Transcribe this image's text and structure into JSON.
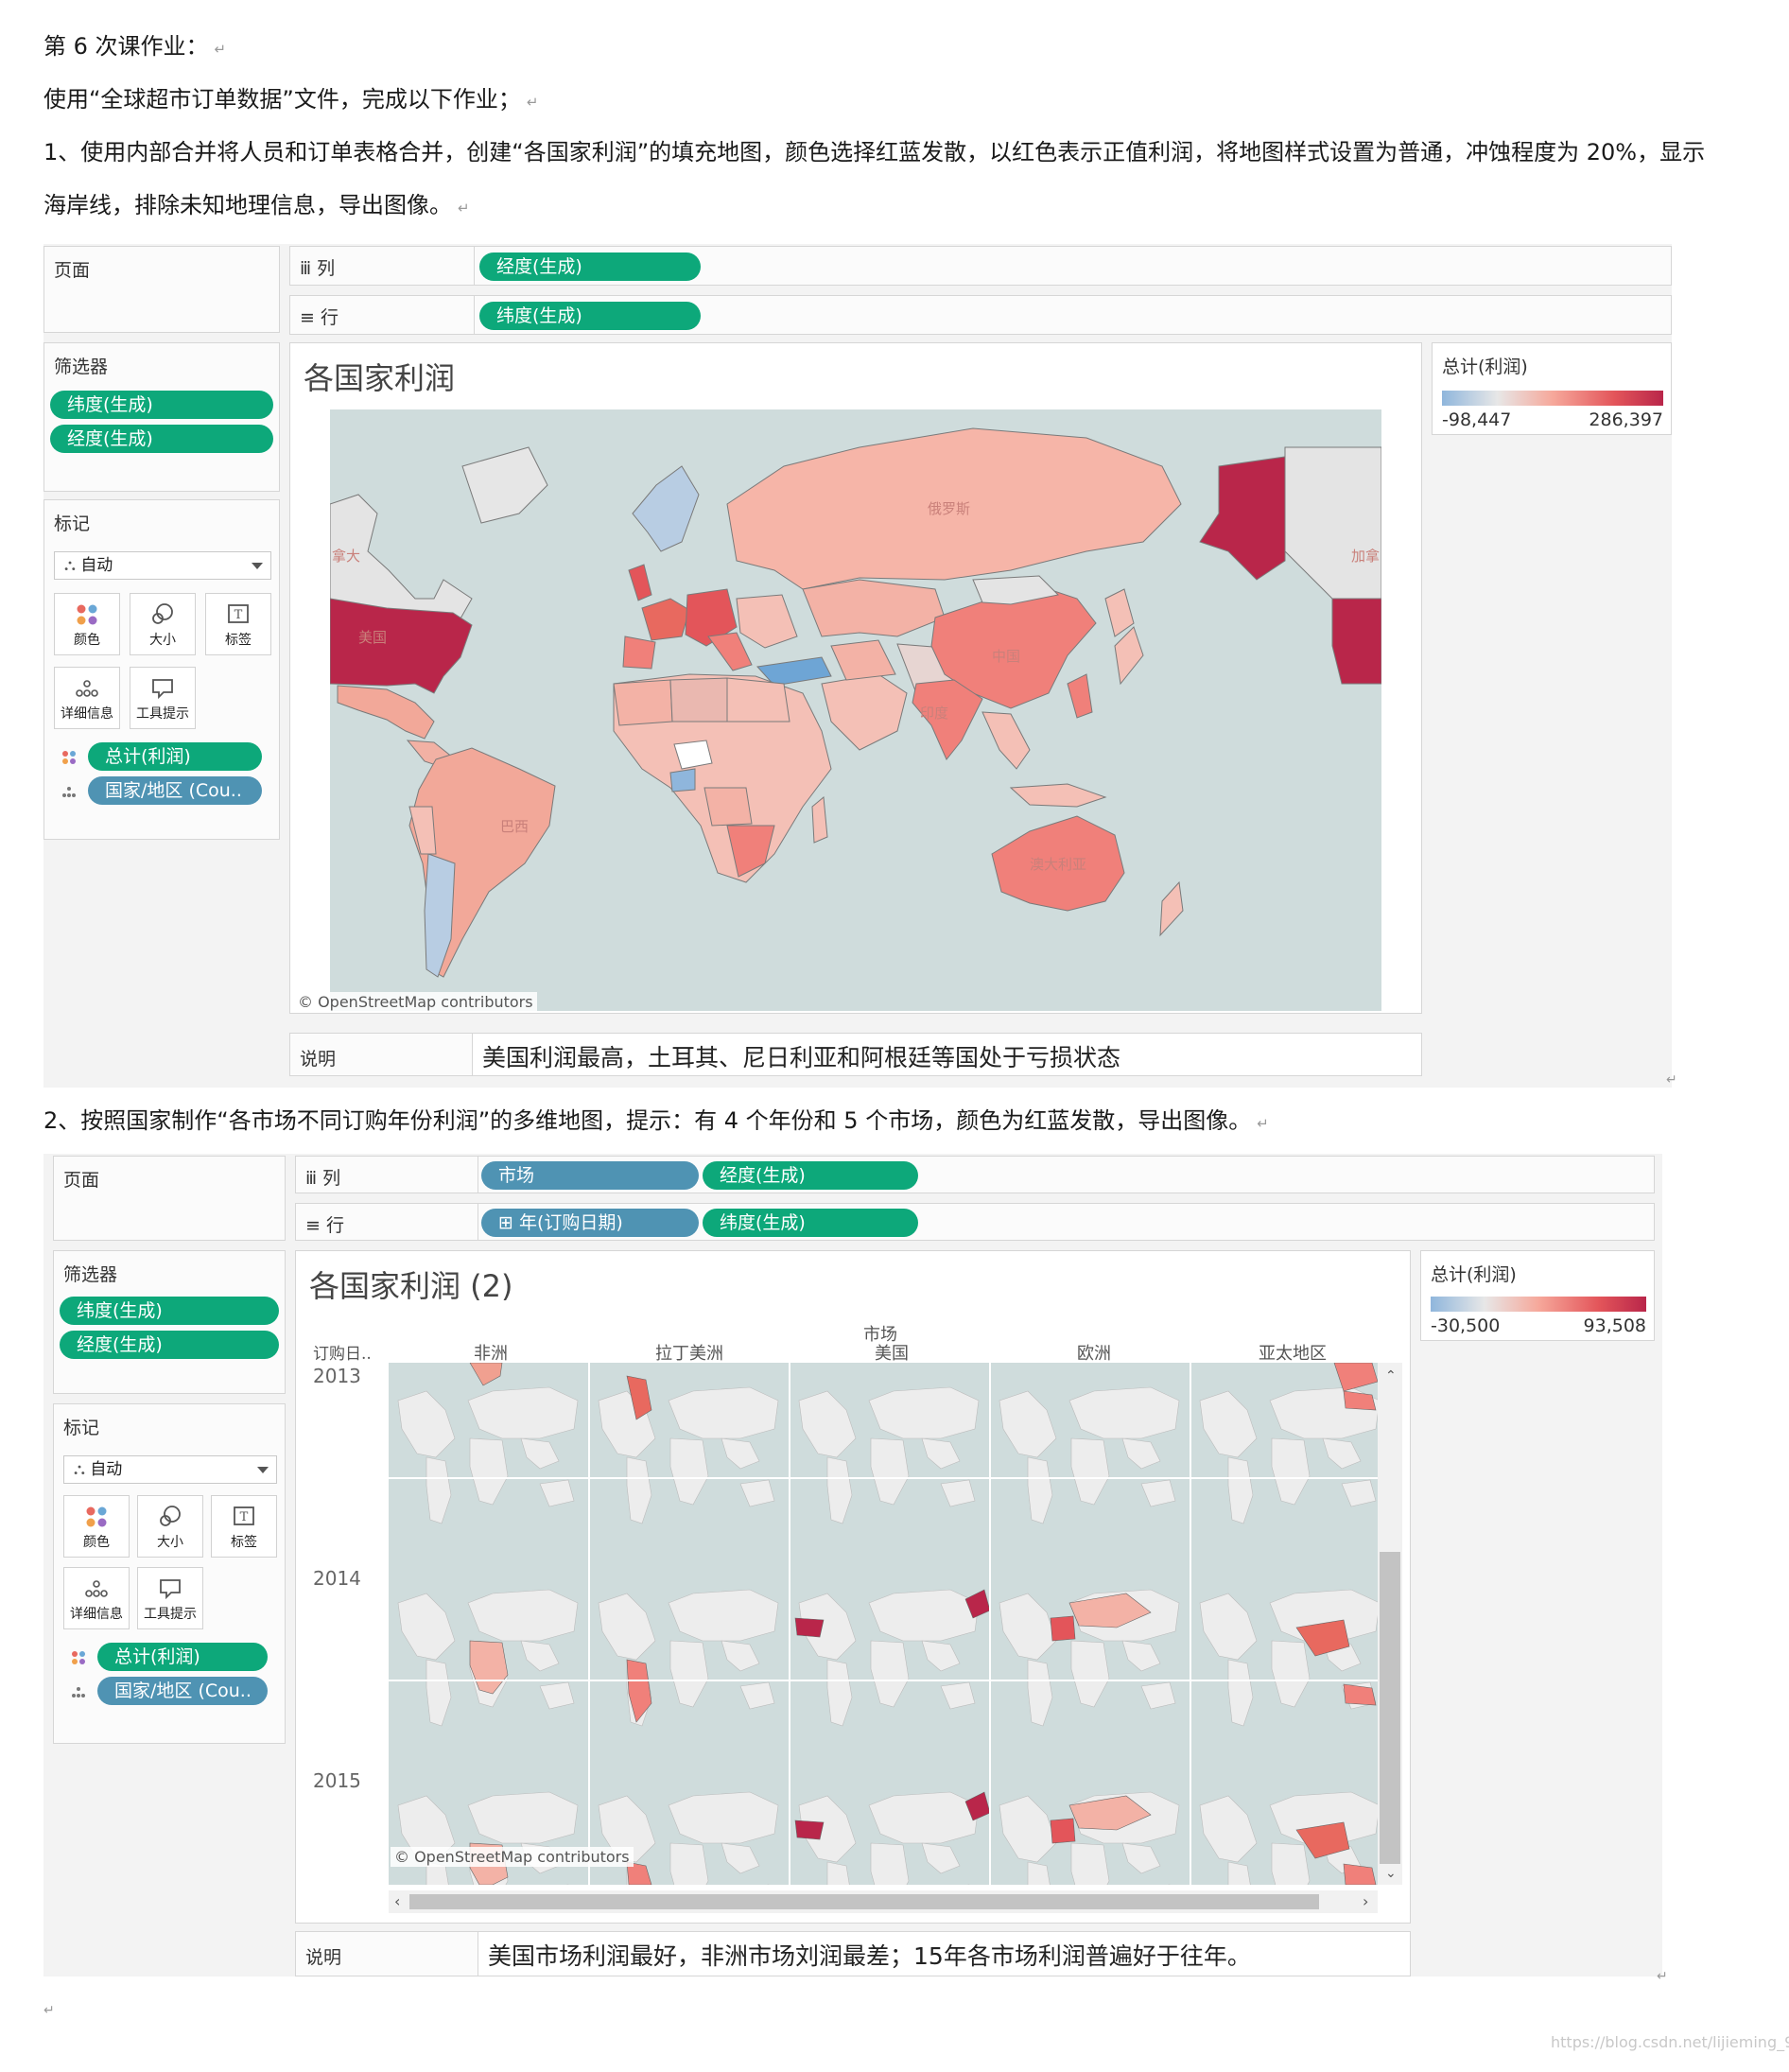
{
  "doc": {
    "line1": "第 6 次课作业：",
    "line2": "使用“全球超市订单数据”文件，完成以下作业；",
    "line3": "1、使用内部合并将人员和订单表格合并，创建“各国家利润”的填充地图，颜色选择红蓝发散，以红色表示正值利润，将地图样式设置为普通，冲蚀程度为 20%，显示",
    "line4": "海岸线，排除未知地理信息，导出图像。",
    "line5": "2、按照国家制作“各市场不同订购年份利润”的多维地图，提示：有 4 个年份和 5 个市场，颜色为红蓝发散，导出图像。",
    "para_mark": "↵",
    "watermark": "https://blog.csdn.net/lijieming_95"
  },
  "viz1": {
    "pages_label": "页面",
    "columns_label": "列",
    "rows_label": "行",
    "columns_pills": [
      "经度(生成)"
    ],
    "rows_pills": [
      "纬度(生成)"
    ],
    "filters_label": "筛选器",
    "filters": [
      "纬度(生成)",
      "经度(生成)"
    ],
    "marks_label": "标记",
    "mark_type": "自动",
    "mark_buttons": [
      "颜色",
      "大小",
      "标签",
      "详细信息",
      "工具提示"
    ],
    "mark_fields": [
      "总计(利润)",
      "国家/地区 (Cou.."
    ],
    "title": "各国家利润",
    "legend_title": "总计(利润)",
    "legend_min": "-98,447",
    "legend_max": "286,397",
    "osm": "© OpenStreetMap contributors",
    "map_labels": [
      "俄罗斯",
      "中国",
      "印度",
      "美国",
      "巴西",
      "澳大利亚",
      "加拿",
      "拿大"
    ],
    "caption_label": "说明",
    "caption": "美国利润最高，土耳其、尼日利亚和阿根廷等国处于亏损状态"
  },
  "viz2": {
    "pages_label": "页面",
    "columns_label": "列",
    "rows_label": "行",
    "columns_pills": [
      "市场",
      "经度(生成)"
    ],
    "rows_pills": [
      "⊞ 年(订购日期)",
      "纬度(生成)"
    ],
    "filters_label": "筛选器",
    "filters": [
      "纬度(生成)",
      "经度(生成)"
    ],
    "marks_label": "标记",
    "mark_type": "自动",
    "mark_buttons": [
      "颜色",
      "大小",
      "标签",
      "详细信息",
      "工具提示"
    ],
    "mark_fields": [
      "总计(利润)",
      "国家/地区 (Cou.."
    ],
    "title": "各国家利润 (2)",
    "market_header": "市场",
    "year_header": "订购日..",
    "markets": [
      "非洲",
      "拉丁美洲",
      "美国",
      "欧洲",
      "亚太地区"
    ],
    "years": [
      "2013",
      "2014",
      "2015"
    ],
    "legend_title": "总计(利润)",
    "legend_min": "-30,500",
    "legend_max": "93,508",
    "osm": "© OpenStreetMap contributors",
    "caption_label": "说明",
    "caption": "美国市场利润最好，非洲市场刘润最差；15年各市场利润普遍好于往年。"
  },
  "colors": {
    "green_pill": "#0da87a",
    "blue_pill": "#4f93b3",
    "ocean": "#cfdcdc",
    "legend_neg": "#8fb6dc",
    "legend_pos": "#b9264a"
  }
}
